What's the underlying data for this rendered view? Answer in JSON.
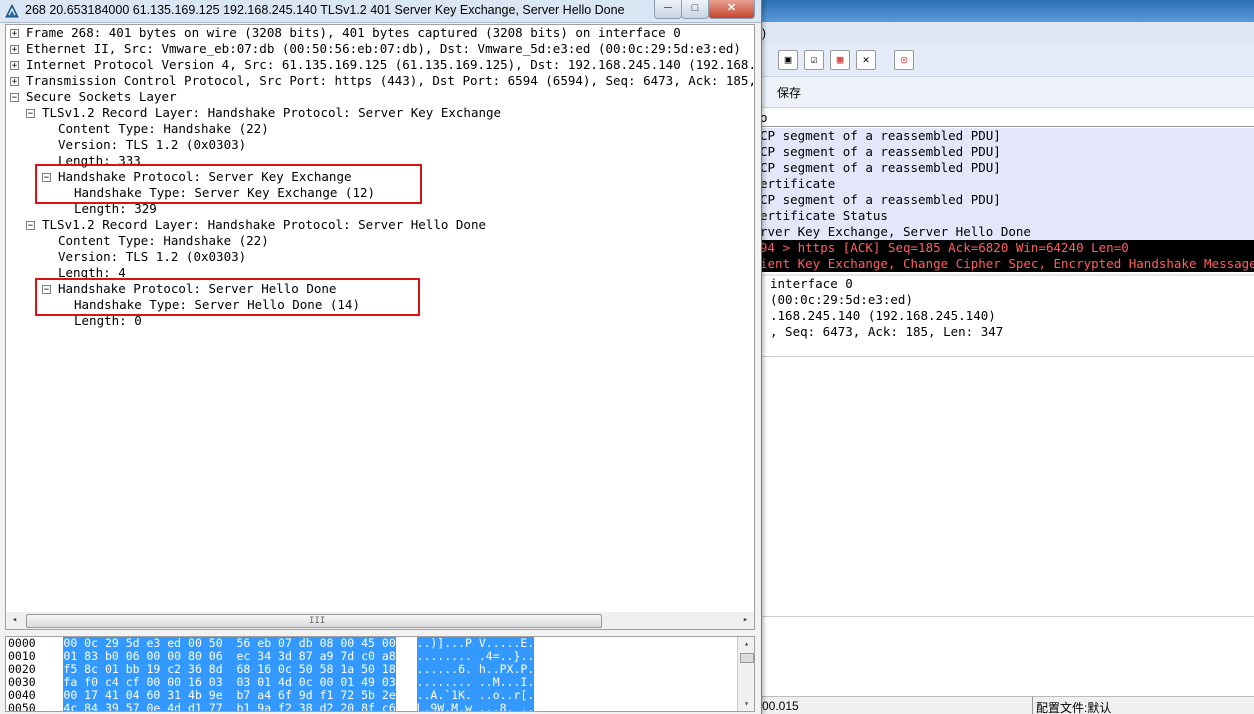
{
  "window_title": "268 20.653184000 61.135.169.125 192.168.245.140 TLSv1.2 401 Server Key Exchange, Server Hello Done",
  "window_buttons": {
    "minimize": "─",
    "maximize": "□",
    "close": "✕"
  },
  "tree": {
    "frame": "Frame 268: 401 bytes on wire (3208 bits), 401 bytes captured (3208 bits) on interface 0",
    "ethernet": "Ethernet II, Src: Vmware_eb:07:db (00:50:56:eb:07:db), Dst: Vmware_5d:e3:ed (00:0c:29:5d:e3:ed)",
    "ip": "Internet Protocol Version 4, Src: 61.135.169.125 (61.135.169.125), Dst: 192.168.245.140 (192.168.245.140)",
    "tcp": "Transmission Control Protocol, Src Port: https (443), Dst Port: 6594 (6594), Seq: 6473, Ack: 185, Len: 347",
    "ssl": "Secure Sockets Layer",
    "rec1": {
      "title": "TLSv1.2 Record Layer: Handshake Protocol: Server Key Exchange",
      "content_type": "Content Type: Handshake (22)",
      "version": "Version: TLS 1.2 (0x0303)",
      "length": "Length: 333",
      "hs_title": "Handshake Protocol: Server Key Exchange",
      "hs_type": "Handshake Type: Server Key Exchange (12)",
      "hs_length": "Length: 329"
    },
    "rec2": {
      "title": "TLSv1.2 Record Layer: Handshake Protocol: Server Hello Done",
      "content_type": "Content Type: Handshake (22)",
      "version": "Version: TLS 1.2 (0x0303)",
      "length": "Length: 4",
      "hs_title": "Handshake Protocol: Server Hello Done",
      "hs_type": "Handshake Type: Server Hello Done (14)",
      "hs_length": "Length: 0"
    }
  },
  "hscroll_grip": "III",
  "bytes": [
    {
      "offset": "0000",
      "hex": "00 0c 29 5d e3 ed 00 50  56 eb 07 db 08 00 45 00",
      "ascii": "..)]...P V.....E."
    },
    {
      "offset": "0010",
      "hex": "01 83 b0 06 00 00 80 06  ec 34 3d 87 a9 7d c0 a8",
      "ascii": "........ .4=..}.."
    },
    {
      "offset": "0020",
      "hex": "f5 8c 01 bb 19 c2 36 8d  68 16 0c 50 58 1a 50 18",
      "ascii": "......6. h..PX.P."
    },
    {
      "offset": "0030",
      "hex": "fa f0 c4 cf 00 00 16 03  03 01 4d 0c 00 01 49 03",
      "ascii": "........ ..M...I."
    },
    {
      "offset": "0040",
      "hex": "00 17 41 04 60 31 4b 9e  b7 a4 6f 9d f1 72 5b 2e",
      "ascii": "..A.`1K. ..o..r[."
    },
    {
      "offset": "0050",
      "hex": "4c 84 39 57 0e 4d d1 77  b1 9a f2 38 d2 20 8f c6",
      "ascii": "L.9W.M.w ...8. .."
    }
  ],
  "bg": {
    "menu_fragment": ")",
    "filter_save": "保存",
    "list_header": "o",
    "packet_rows": [
      "CP segment of a reassembled PDU]",
      "CP segment of a reassembled PDU]",
      "CP segment of a reassembled PDU]",
      "ertificate",
      "CP segment of a reassembled PDU]",
      "ertificate Status",
      "rver Key Exchange, Server Hello Done",
      "94 > https [ACK] Seq=185 Ack=6820 Win=64240 Len=0",
      "ient Key Exchange, Change Cipher Spec, Encrypted Handshake Message"
    ],
    "detail_rows": [
      "interface 0",
      "(00:0c:29:5d:e3:ed)",
      ".168.245.140 (192.168.245.140)",
      ", Seq: 6473, Ack: 185, Len: 347"
    ],
    "status_left": "00.015",
    "status_profile": "配置文件:默认"
  }
}
